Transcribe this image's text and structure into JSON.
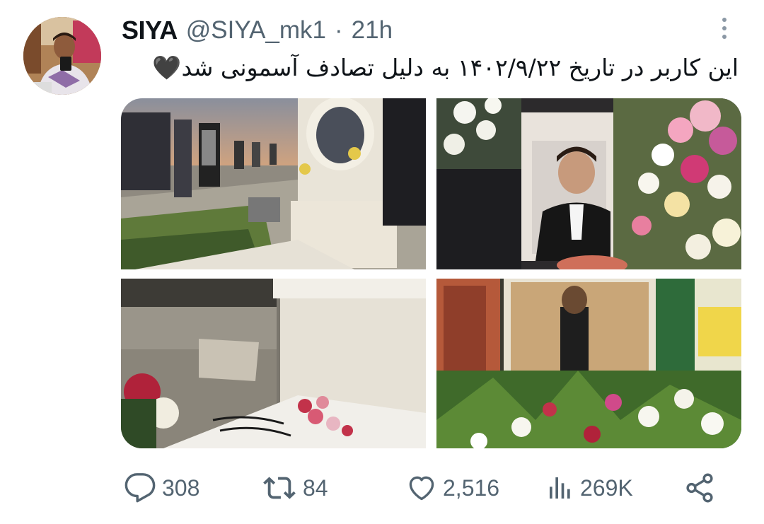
{
  "tweet": {
    "display_name": "SIYA",
    "handle": "@SIYA_mk1",
    "separator": "·",
    "time_ago": "21h",
    "text": "این کاربر در تاریخ ۱۴۰۲/۹/۲۲ به دلیل تصادف آسمونی شد🖤"
  },
  "media": [
    {
      "id": "grave-sunset",
      "description_icon": "photo"
    },
    {
      "id": "portrait-flowers",
      "description_icon": "photo"
    },
    {
      "id": "headstone-petals",
      "description_icon": "photo"
    },
    {
      "id": "gladiolus-photo",
      "description_icon": "photo"
    }
  ],
  "actions": {
    "replies": "308",
    "retweets": "84",
    "likes": "2,516",
    "views": "269K"
  },
  "icons": {
    "reply": "reply-icon",
    "retweet": "retweet-icon",
    "like": "heart-icon",
    "views": "views-icon",
    "share": "share-icon",
    "more": "more-vertical-icon"
  },
  "colors": {
    "text_primary": "#0f1419",
    "text_secondary": "#536471"
  }
}
